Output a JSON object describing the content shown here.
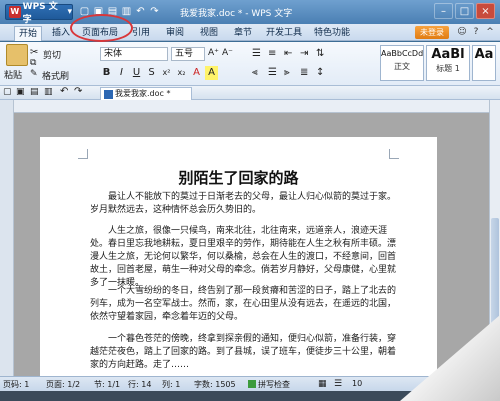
{
  "app": {
    "name": "WPS 文字",
    "window_title": "我爱我家.doc * - WPS 文字"
  },
  "menu": {
    "tabs": [
      "开始",
      "插入",
      "页面布局",
      "引用",
      "审阅",
      "视图",
      "章节",
      "开发工具",
      "特色功能"
    ],
    "login": "未登录"
  },
  "ribbon": {
    "paste": "粘贴",
    "cut": "剪切",
    "format_painter": "格式刷",
    "font_name": "宋体",
    "font_size": "五号",
    "styles": [
      {
        "preview": "AaBbCcDd",
        "name": "正文"
      },
      {
        "preview": "AaBl",
        "name": "标题 1"
      },
      {
        "preview": "Aa",
        "name": ""
      }
    ]
  },
  "doc_tab": "我爱我家.doc *",
  "document": {
    "title": "别陌生了回家的路",
    "paragraphs": [
      "最让人不能放下的莫过于日渐老去的父母，最让人归心似箭的莫过于家。岁月默然远去，这种情怀总会历久势旧的。",
      "人生之旅，很像一只候鸟，南来北往，北往南来，远道亲人，浪迹天涯处。春日里忘我地耕耘，夏日里艰辛的劳作，期待能在人生之秋有所丰硕。漂漫人生之旅，无论何以繁华，何以桑榆，总会在人生的渡口，不经意间，回首故土，回首老屋，萌生一种对父母的牵念。倘若岁月静好，父母康健，心里就多了一抹暖。",
      "一个大雪纷纷的冬日，终告别了那一段贫瘠和苦涩的日子，踏上了北去的列车，成为一名空军战士。然而，家，在心田里从没有远去，在遥远的北国，依然守望着家园，牵念着年迈的父母。",
      "一个暮色苍茫的傍晚，终拿到探亲假的通知，便归心似箭，准备行装，穿越茫茫夜色，踏上了回家的路。到了县城，误了班车，便徒步三十公里，朝着家的方向赶路。走了……"
    ]
  },
  "status": {
    "page": "页码: 1",
    "pages": "页面: 1/2",
    "section": "节: 1/1",
    "line": "行: 14",
    "col": "列: 1",
    "words": "字数: 1505",
    "spell": "拼写检查",
    "zoom": "10"
  }
}
